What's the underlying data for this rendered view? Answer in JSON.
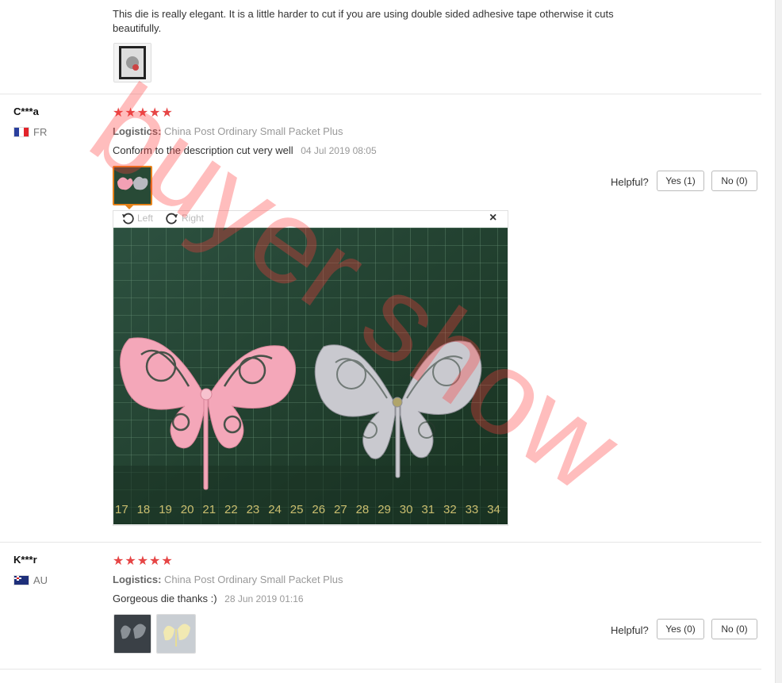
{
  "reviews": [
    {
      "text": "This die is really elegant. It is a little harder to cut if you are using double sided adhesive tape otherwise it cuts beautifully."
    },
    {
      "name": "C***a",
      "country": "FR",
      "stars": "★★★★★",
      "logistics_label": "Logistics:",
      "logistics_value": "China Post Ordinary Small Packet Plus",
      "text": "Conform to the description cut very well",
      "date": "04 Jul 2019 08:05",
      "helpful_label": "Helpful?",
      "yes_label": "Yes (1)",
      "no_label": "No (0)"
    },
    {
      "name": "K***r",
      "country": "AU",
      "stars": "★★★★★",
      "logistics_label": "Logistics:",
      "logistics_value": "China Post Ordinary Small Packet Plus",
      "text": "Gorgeous die thanks :)",
      "date": "28 Jun 2019 01:16",
      "helpful_label": "Helpful?",
      "yes_label": "Yes (0)",
      "no_label": "No (0)"
    }
  ],
  "viewer": {
    "rotate_left_label": "Left",
    "rotate_right_label": "Right",
    "close_glyph": "×",
    "ruler_numbers": [
      "17",
      "18",
      "19",
      "20",
      "21",
      "22",
      "23",
      "24",
      "25",
      "26",
      "27",
      "28",
      "29",
      "30",
      "31",
      "32",
      "33",
      "34"
    ]
  },
  "watermark": {
    "text": "buyer show",
    "color": "#ff3b3b"
  },
  "colors": {
    "star": "#e64545",
    "active_thumb_border": "#e6821a",
    "mat_green": "#1f3d2e"
  }
}
